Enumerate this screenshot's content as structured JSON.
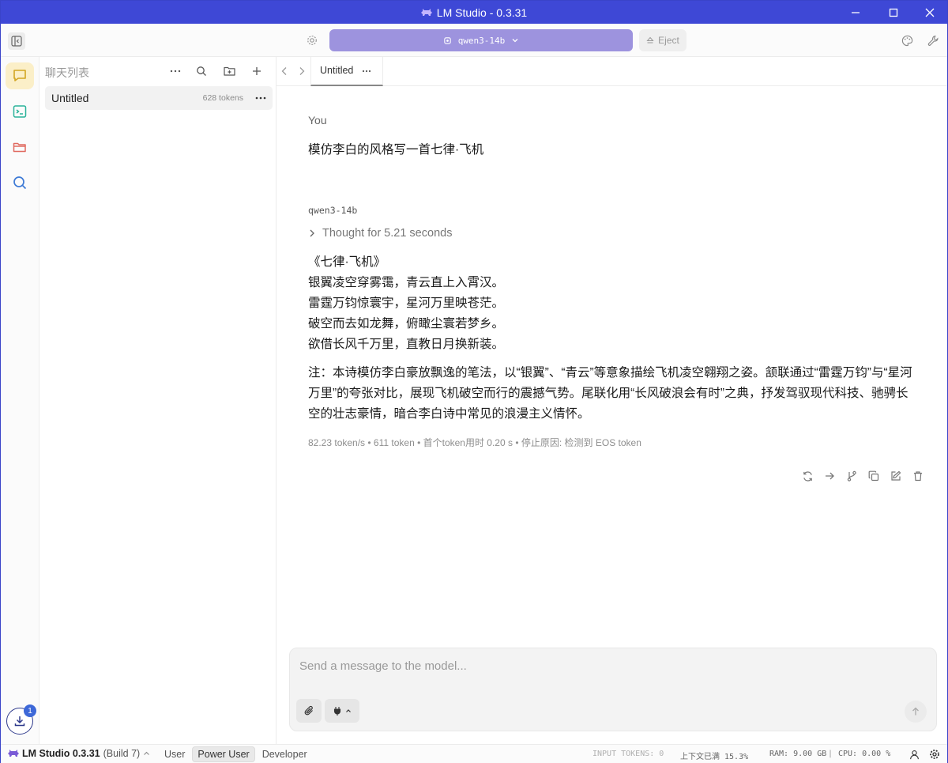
{
  "window": {
    "title": "LM Studio - 0.3.31"
  },
  "toolbar": {
    "model_name": "qwen3-14b",
    "eject_label": "Eject"
  },
  "chat_list": {
    "title": "聊天列表",
    "items": [
      {
        "name": "Untitled",
        "tokens": "628 tokens"
      }
    ]
  },
  "tabs": [
    {
      "label": "Untitled"
    }
  ],
  "conversation": {
    "user_label": "You",
    "user_message": "模仿李白的风格写一首七律·飞机",
    "model_label": "qwen3-14b",
    "thought": "Thought for 5.21 seconds",
    "poem_lines": [
      "《七律·飞机》",
      "银翼凌空穿雾霭，青云直上入霄汉。",
      "雷霆万钧惊寰宇，星河万里映苍茫。",
      "破空而去如龙舞，俯瞰尘寰若梦乡。",
      "欲借长风千万里，直教日月换新装。"
    ],
    "note": "注：本诗模仿李白豪放飘逸的笔法，以“银翼”、“青云”等意象描绘飞机凌空翱翔之姿。颔联通过“雷霆万钧”与“星河万里”的夸张对比，展现飞机破空而行的震撼气势。尾联化用“长风破浪会有时”之典，抒发驾驭现代科技、驰骋长空的壮志豪情，暗合李白诗中常见的浪漫主义情怀。",
    "stats": "82.23 token/s • 611 token • 首个token用时 0.20 s • 停止原因: 检测到 EOS token"
  },
  "input": {
    "placeholder": "Send a message to the model..."
  },
  "download_badge": "1",
  "statusbar": {
    "app_name": "LM Studio 0.3.31",
    "build": "(Build 7)",
    "modes": [
      "User",
      "Power User",
      "Developer"
    ],
    "active_mode": "Power User",
    "input_tokens": "INPUT TOKENS: 0",
    "context": "上下文已满 15.3%",
    "ram": "RAM: 9.00 GB",
    "cpu": "CPU: 0.00 %"
  },
  "colors": {
    "titlebar": "#3e48d6",
    "model_pill": "#9d93de",
    "active_rail": "#fbefc8",
    "badge": "#3d68d8"
  }
}
